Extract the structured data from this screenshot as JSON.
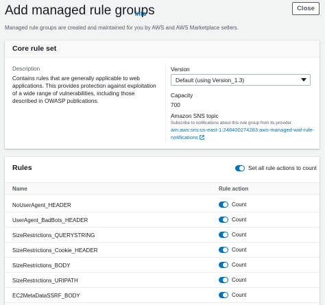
{
  "header": {
    "title": "Add managed rule groups",
    "info_label": "Info",
    "close_label": "Close",
    "subtitle": "Managed rule groups are created and maintained for you by AWS and AWS Marketplace sellers."
  },
  "core_rule_set": {
    "title": "Core rule set",
    "description_label": "Description",
    "description": "Contains rules that are generally applicable to web applications. This provides protection against exploitation of a wide range of vulnerabilities, including those described in OWASP publications.",
    "version_label": "Version",
    "version_selected": "Default (using Version_1.3)",
    "capacity_label": "Capacity",
    "capacity_value": "700",
    "sns_label": "Amazon SNS topic",
    "sns_description": "Subscribe to notifications about this rule group from its provider.",
    "sns_arn": "arn:aws:sns:us-east-1:248400274283:aws-managed-waf-rule-notifications"
  },
  "rules": {
    "title": "Rules",
    "set_all_label": "Set all rule actions to count",
    "set_all_enabled": true,
    "columns": {
      "name": "Name",
      "action": "Rule action"
    },
    "items": [
      {
        "name": "NoUserAgent_HEADER",
        "action": "Count",
        "enabled": true
      },
      {
        "name": "UserAgent_BadBots_HEADER",
        "action": "Count",
        "enabled": true
      },
      {
        "name": "SizeRestrictions_QUERYSTRING",
        "action": "Count",
        "enabled": true
      },
      {
        "name": "SizeRestrictions_Cookie_HEADER",
        "action": "Count",
        "enabled": true
      },
      {
        "name": "SizeRestrictions_BODY",
        "action": "Count",
        "enabled": true
      },
      {
        "name": "SizeRestrictions_URIPATH",
        "action": "Count",
        "enabled": true
      },
      {
        "name": "EC2MetaDataSSRF_BODY",
        "action": "Count",
        "enabled": true
      }
    ]
  },
  "colors": {
    "accent": "#0073bb",
    "background": "#f2f3f3",
    "text": "#16191f",
    "muted_text": "#545b64"
  },
  "icons": {
    "select_caret": "caret-down-icon",
    "external_link": "external-link-icon",
    "toggle": "toggle-switch"
  }
}
